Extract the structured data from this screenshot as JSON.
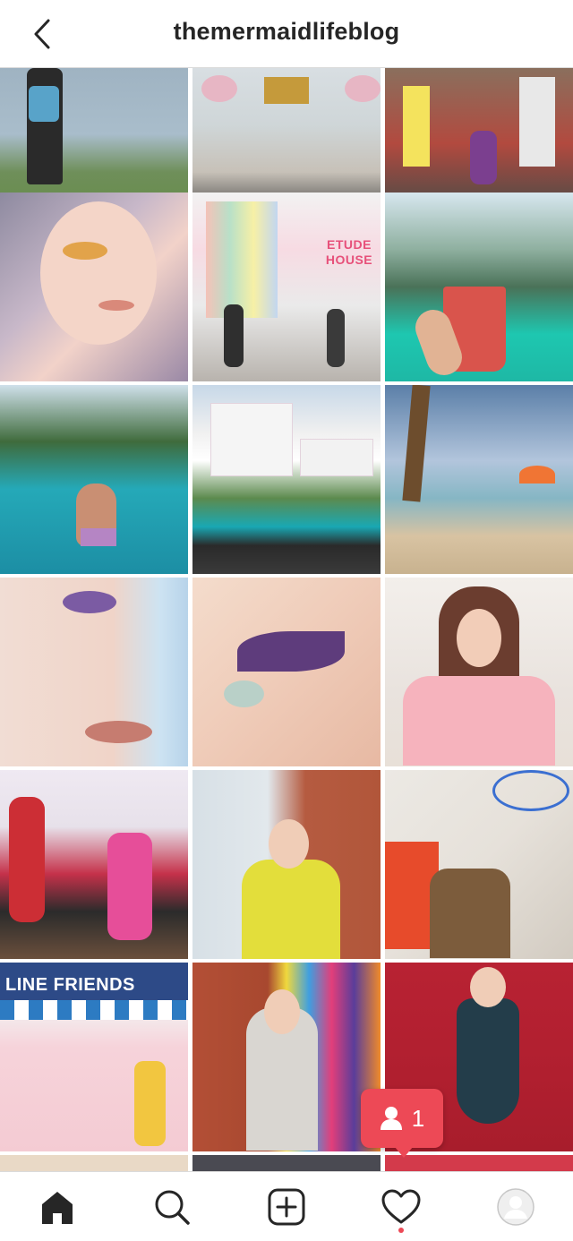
{
  "header": {
    "username": "themermaidlifeblog",
    "back_icon": "chevron-left-icon"
  },
  "grid": {
    "posts": [
      {
        "label": "",
        "caption": "girl by lake with backpack"
      },
      {
        "label": "",
        "caption": "temple with cherry blossoms"
      },
      {
        "label": "",
        "caption": "busy street with signs"
      },
      {
        "label": "",
        "caption": "glitter eye makeup portrait"
      },
      {
        "label": "ETUDE HOUSE",
        "caption": "etude house storefront"
      },
      {
        "label": "",
        "caption": "smoothie drink by pool"
      },
      {
        "label": "",
        "caption": "woman in pool with palms"
      },
      {
        "label": "",
        "caption": "hotel infinity pool"
      },
      {
        "label": "",
        "caption": "beach with palm trees"
      },
      {
        "label": "",
        "caption": "purple eye close-up"
      },
      {
        "label": "",
        "caption": "purple eyeliner makeup"
      },
      {
        "label": "",
        "caption": "woman in pink heart sweater"
      },
      {
        "label": "",
        "caption": "group hug with children"
      },
      {
        "label": "",
        "caption": "woman in yellow jacket"
      },
      {
        "label": "",
        "caption": "woman against graffiti wall"
      },
      {
        "label": "LINE FRIENDS",
        "caption": "line friends storefront"
      },
      {
        "label": "",
        "caption": "woman by rainbow wall"
      },
      {
        "label": "",
        "caption": "woman in dress on red wall"
      }
    ]
  },
  "notification": {
    "count": "1",
    "icon": "person-icon",
    "color": "#ed4956"
  },
  "nav": {
    "items": [
      "home-icon",
      "search-icon",
      "new-post-icon",
      "activity-heart-icon",
      "profile-avatar"
    ]
  },
  "colors": {
    "accent": "#ed4956",
    "border": "#dbdbdb",
    "text": "#262626"
  }
}
